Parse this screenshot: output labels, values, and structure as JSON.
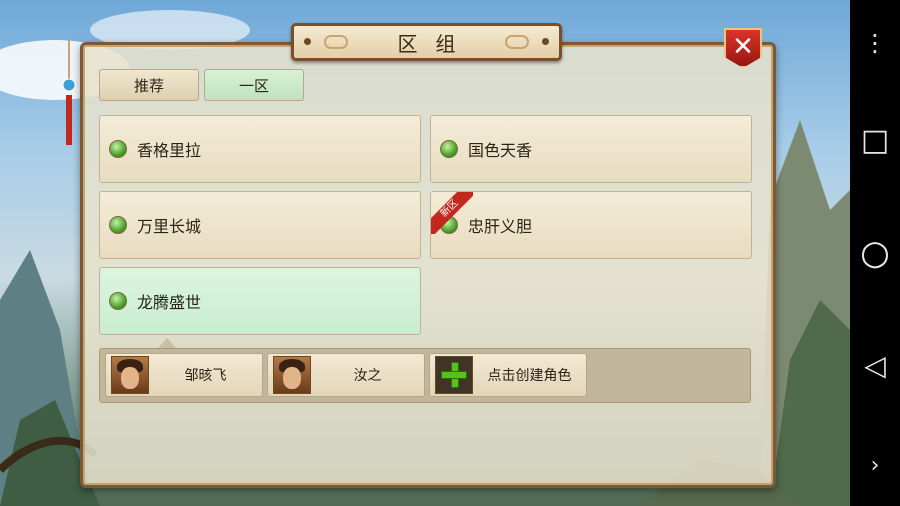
{
  "dialog": {
    "title": "区组"
  },
  "tabs": [
    {
      "label": "推荐",
      "active": false
    },
    {
      "label": "一区",
      "active": true
    }
  ],
  "servers": [
    {
      "name": "香格里拉",
      "status_color": "#4ca12a",
      "selected": false,
      "badge": ""
    },
    {
      "name": "国色天香",
      "status_color": "#4ca12a",
      "selected": false,
      "badge": ""
    },
    {
      "name": "万里长城",
      "status_color": "#4ca12a",
      "selected": false,
      "badge": ""
    },
    {
      "name": "忠肝义胆",
      "status_color": "#4ca12a",
      "selected": false,
      "badge": "新区"
    },
    {
      "name": "龙腾盛世",
      "status_color": "#4ca12a",
      "selected": true,
      "badge": ""
    }
  ],
  "roles": [
    {
      "name": "邹晐飞",
      "icon": "portrait-icon"
    },
    {
      "name": "汝之",
      "icon": "portrait-icon"
    }
  ],
  "create_role": {
    "label": "点击创建角色",
    "icon": "plus-icon"
  },
  "close": {
    "icon": "close-icon",
    "glyph": "✕"
  },
  "android_nav": {
    "menu": "⋮",
    "recents": "□",
    "home": "○",
    "back": "◁",
    "more": "›"
  },
  "colors": {
    "accent_green": "#c9ecd0",
    "close_red": "#c3281e",
    "frame_brown": "#7a5a36"
  }
}
